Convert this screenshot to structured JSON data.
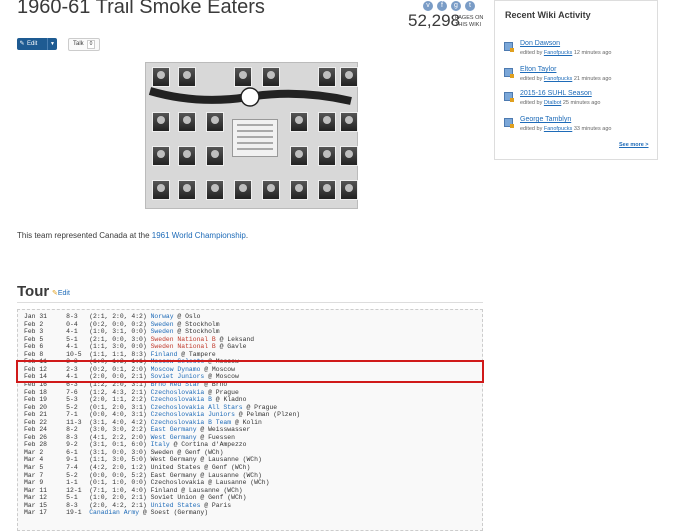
{
  "page": {
    "title": "1960-61 Trail Smoke Eaters",
    "pages_count": "52,298",
    "pages_label": "PAGES ON THIS WIKI"
  },
  "social": [
    "vk-icon",
    "facebook-icon",
    "googleplus-icon",
    "twitter-icon"
  ],
  "buttons": {
    "edit_label": "Edit",
    "talk_label": "Talk",
    "talk_count": "0"
  },
  "intro": {
    "prefix": "This team represented Canada at the ",
    "link": "1961 World Championship",
    "suffix": "."
  },
  "section": {
    "heading": "Tour",
    "edit_label": "Edit"
  },
  "tour_rows": [
    {
      "date": "Jan 31",
      "score": "8-3",
      "periods": "(2:1, 2:0, 4:2)",
      "opponent": "Norway",
      "style": "team",
      "location": " @ Oslo"
    },
    {
      "date": "Feb 2",
      "score": "0-4",
      "periods": "(0:2, 0:0, 0:2)",
      "opponent": "Sweden",
      "style": "team",
      "location": " @ Stockholm"
    },
    {
      "date": "Feb 3",
      "score": "4-1",
      "periods": "(1:0, 3:1, 0:0)",
      "opponent": "Sweden",
      "style": "team",
      "location": " @ Stockholm"
    },
    {
      "date": "Feb 5",
      "score": "5-1",
      "periods": "(2:1, 0:0, 3:0)",
      "opponent": "Sweden National B",
      "style": "red",
      "location": " @ Leksand"
    },
    {
      "date": "Feb 6",
      "score": "4-1",
      "periods": "(1:1, 3:0, 0:0)",
      "opponent": "Sweden National B",
      "style": "red",
      "location": " @ Gavle"
    },
    {
      "date": "Feb 8",
      "score": "10-5",
      "periods": "(1:1, 1:1, 8:3)",
      "opponent": "Finland",
      "style": "team",
      "location": " @ Tampere"
    },
    {
      "date": "Feb 11",
      "score": "3-3",
      "periods": "(1:0, 1:2, 1:1)",
      "opponent": "Moscow Selects",
      "style": "team",
      "location": " @ Moscow"
    },
    {
      "date": "Feb 12",
      "score": "2-3",
      "periods": "(0:2, 0:1, 2:0)",
      "opponent": "Moscow Dynamo",
      "style": "team",
      "location": " @ Moscow"
    },
    {
      "date": "Feb 14",
      "score": "4-1",
      "periods": "(2:0, 0:0, 2:1)",
      "opponent": "Soviet Juniors",
      "style": "team",
      "location": " @ Moscow"
    },
    {
      "date": "Feb 16",
      "score": "6-3",
      "periods": "(1:2, 2:0, 3:1)",
      "opponent": "Brno Red Star",
      "style": "team",
      "location": " @ Brno"
    },
    {
      "date": "Feb 18",
      "score": "7-6",
      "periods": "(1:2, 4:3, 2:1)",
      "opponent": "Czechoslovakia",
      "style": "team",
      "location": " @ Prague"
    },
    {
      "date": "Feb 19",
      "score": "5-3",
      "periods": "(2:0, 1:1, 2:2)",
      "opponent": "Czechoslovakia B",
      "style": "team",
      "location": " @ Kladno"
    },
    {
      "date": "Feb 20",
      "score": "5-2",
      "periods": "(0:1, 2:0, 3:1)",
      "opponent": "Czechoslovakia All Stars",
      "style": "team",
      "location": " @ Prague"
    },
    {
      "date": "Feb 21",
      "score": "7-1",
      "periods": "(0:0, 4:0, 3:1)",
      "opponent": "Czechoslovakia Juniors",
      "style": "team",
      "location": " @ Pelman (Plzen)"
    },
    {
      "date": "Feb 22",
      "score": "11-3",
      "periods": "(3:1, 4:0, 4:2)",
      "opponent": "Czechoslovakia B Team",
      "style": "team",
      "location": " @ Kolin"
    },
    {
      "date": "Feb 24",
      "score": "8-2",
      "periods": "(3:0, 3:0, 2:2)",
      "opponent": "East Germany",
      "style": "team",
      "location": " @ Weisswasser"
    },
    {
      "date": "Feb 26",
      "score": "8-3",
      "periods": "(4:1, 2:2, 2:0)",
      "opponent": "West Germany",
      "style": "team",
      "location": " @ Fuessen"
    },
    {
      "date": "Feb 28",
      "score": "9-2",
      "periods": "(3:1, 0:1, 6:0)",
      "opponent": "Italy",
      "style": "team",
      "location": " @ Cortina d'Ampezzo"
    },
    {
      "date": "Mar 2",
      "score": "6-1",
      "periods": "(3:1, 0:0, 3:0)",
      "opponent": "Sweden",
      "style": "plain",
      "location": " @ Genf (WCh)"
    },
    {
      "date": "Mar 4",
      "score": "9-1",
      "periods": "(1:1, 3:0, 5:0)",
      "opponent": "West Germany",
      "style": "plain",
      "location": " @ Lausanne (WCh)"
    },
    {
      "date": "Mar 5",
      "score": "7-4",
      "periods": "(4:2, 2:0, 1:2)",
      "opponent": "United States",
      "style": "plain",
      "location": " @ Genf (WCh)"
    },
    {
      "date": "Mar 7",
      "score": "5-2",
      "periods": "(0:0, 0:0, 5:2)",
      "opponent": "East Germany",
      "style": "plain",
      "location": " @ Lausanne (WCh)"
    },
    {
      "date": "Mar 9",
      "score": "1-1",
      "periods": "(0:1, 1:0, 0:0)",
      "opponent": "Czechoslovakia",
      "style": "plain",
      "location": " @ Lausanne (WCh)"
    },
    {
      "date": "Mar 11",
      "score": "12-1",
      "periods": "(7:1, 1:0, 4:0)",
      "opponent": "Finland",
      "style": "plain",
      "location": " @ Lausanne (WCh)"
    },
    {
      "date": "Mar 12",
      "score": "5-1",
      "periods": "(1:0, 2:0, 2:1)",
      "opponent": "Soviet Union",
      "style": "plain",
      "location": " @ Genf (WCh)"
    },
    {
      "date": "Mar 15",
      "score": "8-3",
      "periods": "(2:0, 4:2, 2:1)",
      "opponent": "United States",
      "style": "team",
      "location": " @ Paris"
    },
    {
      "date": "Mar 17",
      "score": "19-1",
      "periods": "",
      "opponent": "Canadian Army",
      "style": "team",
      "location": " @ Soest (Germany)"
    }
  ],
  "sidebar": {
    "title": "Recent Wiki Activity",
    "items": [
      {
        "title": "Don Dawson",
        "by": "edited by ",
        "user": "Fanofpucks",
        "time": " 12 minutes ago"
      },
      {
        "title": "Elton Taylor",
        "by": "edited by ",
        "user": "Fanofpucks",
        "time": " 21 minutes ago"
      },
      {
        "title": "2015-16 SUHL Season",
        "by": "edited by ",
        "user": "Dtalbot",
        "time": " 25 minutes ago"
      },
      {
        "title": "George Tamblyn",
        "by": "edited by ",
        "user": "Fanofpucks",
        "time": " 33 minutes ago"
      }
    ],
    "see_more": "See more >"
  },
  "colors": {
    "link": "#1e6bb8",
    "red_link": "#c0392b",
    "highlight_border": "#d01a1a",
    "edit_button": "#1e5b92"
  }
}
